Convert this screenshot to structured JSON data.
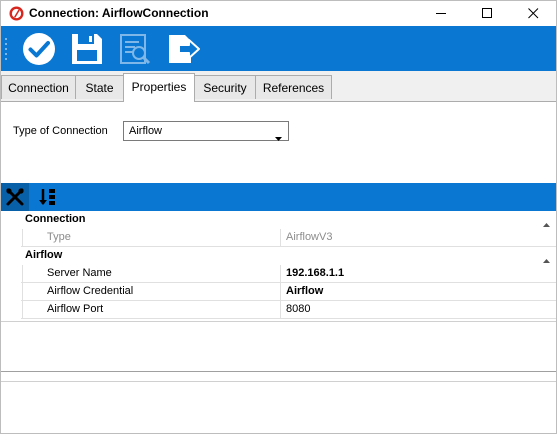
{
  "window": {
    "title": "Connection: AirflowConnection",
    "controls": [
      "minimize-icon",
      "maximize-icon",
      "close-icon"
    ]
  },
  "toolbar": {
    "buttons": [
      "check-icon",
      "save-icon",
      "preview-icon",
      "export-icon"
    ],
    "color": "#0a78d2"
  },
  "tabs": [
    {
      "label": "Connection",
      "active": false
    },
    {
      "label": "State",
      "active": false
    },
    {
      "label": "Properties",
      "active": true
    },
    {
      "label": "Security",
      "active": false
    },
    {
      "label": "References",
      "active": false
    }
  ],
  "connection_type": {
    "label": "Type of Connection",
    "value": "Airflow"
  },
  "grid_toolbar": {
    "buttons": [
      "wrench-icon",
      "sort-alpha-icon"
    ]
  },
  "property_grid": {
    "categories": [
      {
        "name": "Connection",
        "properties": [
          {
            "name": "Type",
            "value": "AirflowV3",
            "readonly": true
          }
        ]
      },
      {
        "name": "Airflow",
        "properties": [
          {
            "name": "Server Name",
            "value": "192.168.1.1",
            "bold": true
          },
          {
            "name": "Airflow Credential",
            "value": "Airflow",
            "bold": true
          },
          {
            "name": "Airflow Port",
            "value": "8080",
            "bold": false
          }
        ]
      }
    ]
  }
}
